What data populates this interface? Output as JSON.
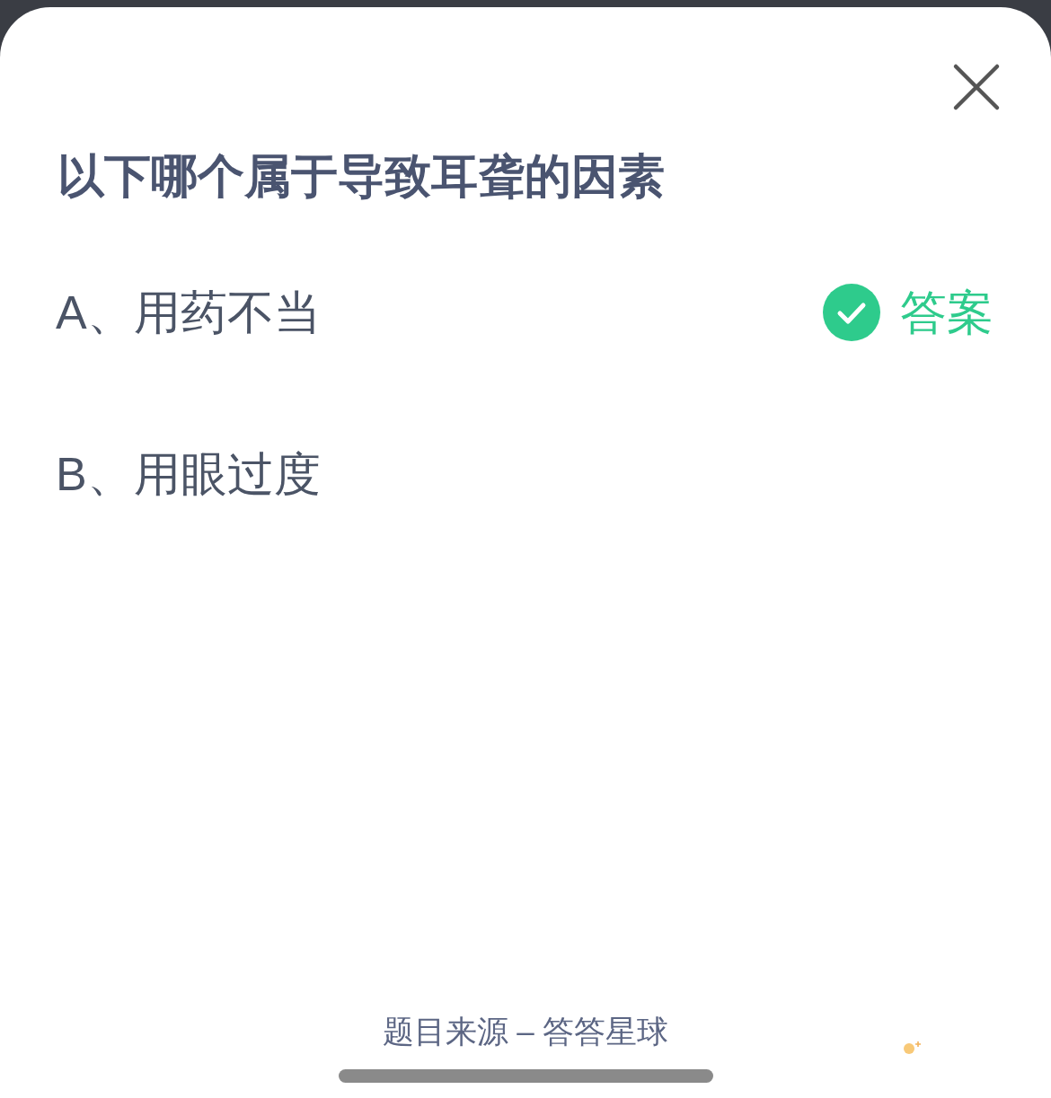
{
  "question": "以下哪个属于导致耳聋的因素",
  "options": [
    {
      "label": "A、用药不当",
      "correct": true
    },
    {
      "label": "B、用眼过度",
      "correct": false
    }
  ],
  "answer_label": "答案",
  "source": "题目来源 – 答答星球"
}
